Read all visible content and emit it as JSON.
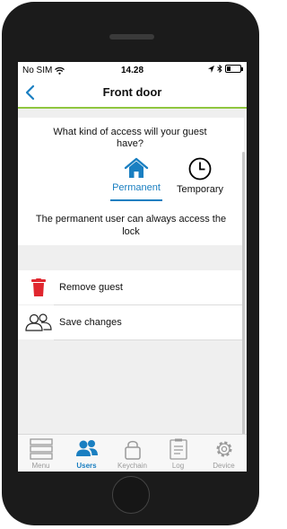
{
  "status_bar": {
    "carrier": "No SIM",
    "time": "14.28",
    "battery_level": 0.3
  },
  "nav": {
    "title": "Front door"
  },
  "access": {
    "question": "What kind of access will your guest have?",
    "options": [
      {
        "label": "Permanent",
        "icon": "house-icon",
        "selected": true
      },
      {
        "label": "Temporary",
        "icon": "clock-icon",
        "selected": false
      }
    ],
    "description": "The permanent user can always access the lock"
  },
  "actions": [
    {
      "label": "Remove guest",
      "icon": "trash-icon"
    },
    {
      "label": "Save changes",
      "icon": "users-icon"
    }
  ],
  "tabs": [
    {
      "label": "Menu",
      "icon": "menu-icon",
      "active": false
    },
    {
      "label": "Users",
      "icon": "users-icon",
      "active": true
    },
    {
      "label": "Keychain",
      "icon": "lock-icon",
      "active": false
    },
    {
      "label": "Log",
      "icon": "log-icon",
      "active": false
    },
    {
      "label": "Device",
      "icon": "gear-icon",
      "active": false
    }
  ],
  "colors": {
    "accent": "#1a7fc1",
    "nav_underline": "#8fc63f",
    "danger": "#e0262e",
    "inactive_tab": "#9a9a9a"
  }
}
